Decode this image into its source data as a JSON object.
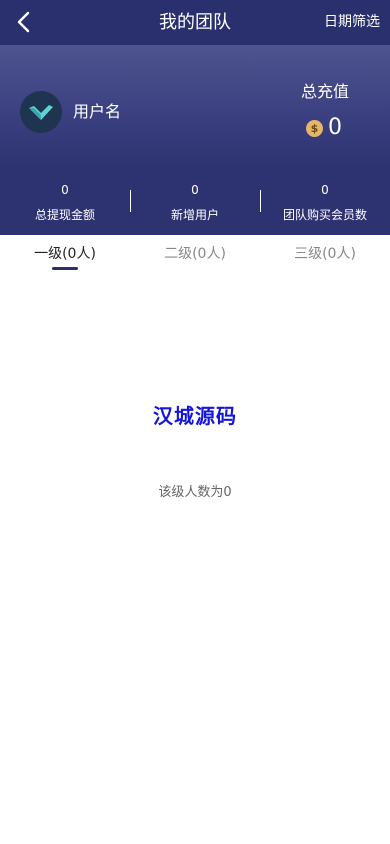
{
  "nav": {
    "title": "我的团队",
    "filter_label": "日期筛选",
    "back_icon": "chevron-left-icon"
  },
  "profile": {
    "username": "用户名",
    "recharge_label": "总充值",
    "recharge_value": "0",
    "coin_symbol": "$"
  },
  "stats": [
    {
      "value": "0",
      "label": "总提现金额"
    },
    {
      "value": "0",
      "label": "新增用户"
    },
    {
      "value": "0",
      "label": "团队购买会员数"
    }
  ],
  "tabs": [
    {
      "label": "一级(0人)",
      "active": true
    },
    {
      "label": "二级(0人)",
      "active": false
    },
    {
      "label": "三级(0人)",
      "active": false
    }
  ],
  "content": {
    "watermark": "汉城源码",
    "empty_text": "该级人数为0"
  },
  "colors": {
    "navbar": "#2a2f6e",
    "accent": "#2a2f6e",
    "watermark": "#1616d8",
    "coin": "#e5b56a"
  }
}
